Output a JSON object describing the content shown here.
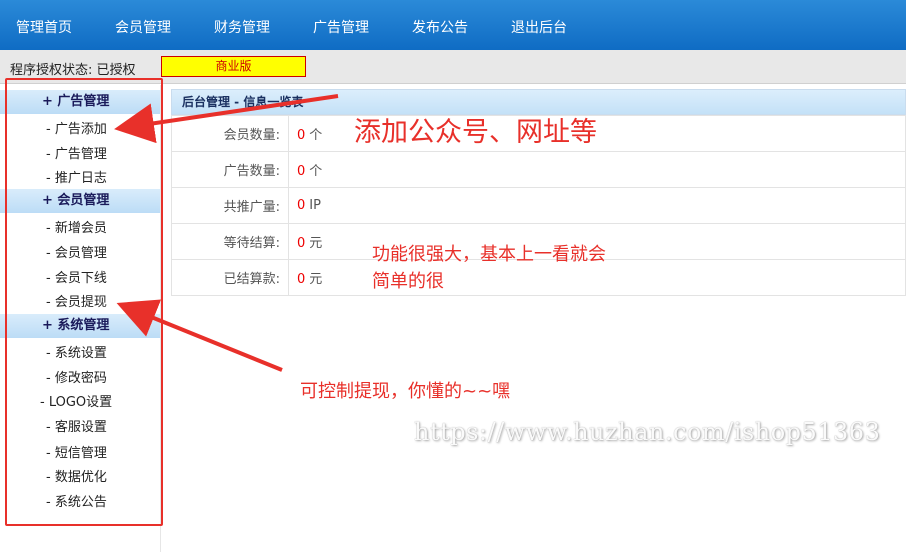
{
  "topnav": {
    "items": [
      "管理首页",
      "会员管理",
      "财务管理",
      "广告管理",
      "发布公告",
      "退出后台"
    ]
  },
  "status": {
    "label": "程序授权状态: 已授权",
    "edition": "商业版"
  },
  "sidebar": {
    "groups": [
      {
        "title": "+ 广告管理",
        "items": [
          "- 广告添加",
          "- 广告管理",
          "- 推广日志"
        ]
      },
      {
        "title": "+ 会员管理",
        "items": [
          "- 新增会员",
          "- 会员管理",
          "- 会员下线",
          "- 会员提现"
        ]
      },
      {
        "title": "+ 系统管理",
        "items": [
          "- 系统设置",
          "- 修改密码",
          "- LOGO设置",
          "- 客服设置",
          "- 短信管理",
          "- 数据优化",
          "- 系统公告"
        ]
      }
    ]
  },
  "panel": {
    "title": "后台管理 - 信息一览表",
    "rows": [
      {
        "label": "会员数量:",
        "value": "0",
        "unit": "个"
      },
      {
        "label": "广告数量:",
        "value": "0",
        "unit": "个"
      },
      {
        "label": "共推广量:",
        "value": "0",
        "unit": "IP"
      },
      {
        "label": "等待结算:",
        "value": "0",
        "unit": "元"
      },
      {
        "label": "已结算款:",
        "value": "0",
        "unit": "元"
      }
    ]
  },
  "annotations": {
    "a1": "添加公众号、网址等",
    "a2_line1": "功能很强大，基本上一看就会",
    "a2_line2": "简单的很",
    "a3": "可控制提现，你懂的~~嘿",
    "watermark": "https://www.huzhan.com/ishop51363"
  },
  "colors": {
    "nav": "#1a78cf",
    "annotation": "#e8302a",
    "value": "#ee0000",
    "badge": "#ffff00"
  }
}
